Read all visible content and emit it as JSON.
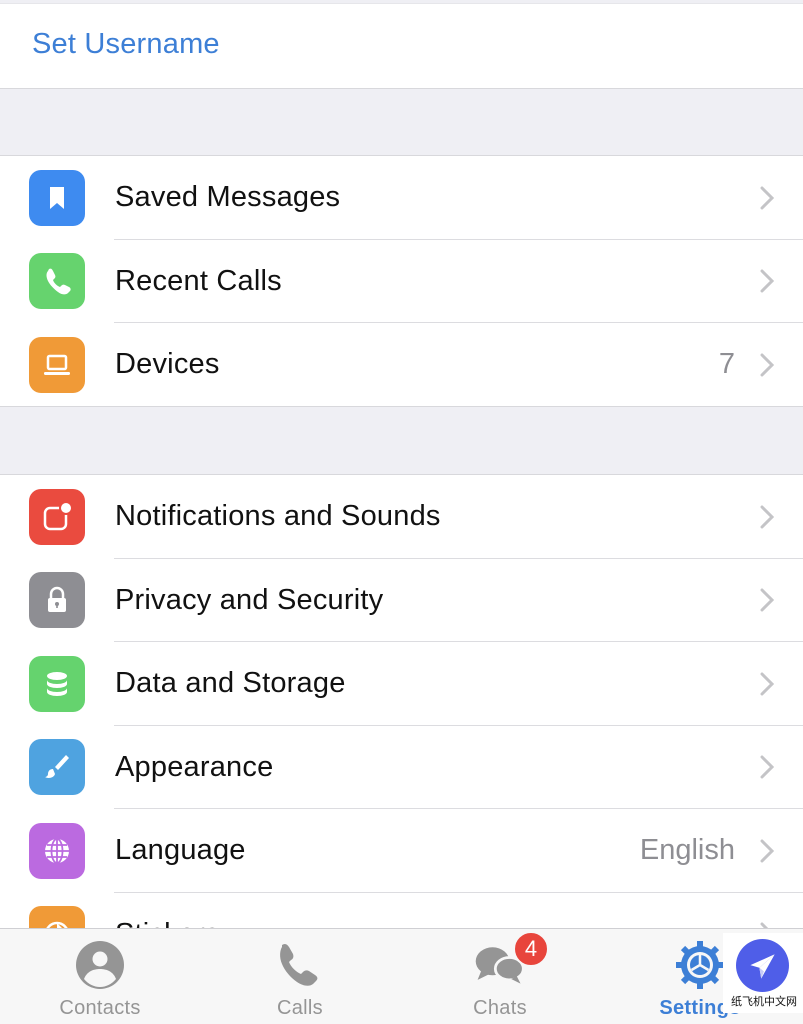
{
  "header": {
    "set_username_label": "Set Username"
  },
  "group1": [
    {
      "label": "Saved Messages",
      "icon": "bookmark-icon",
      "color": "#3e8bf0",
      "value": ""
    },
    {
      "label": "Recent Calls",
      "icon": "phone-icon",
      "color": "#66d36e",
      "value": ""
    },
    {
      "label": "Devices",
      "icon": "laptop-icon",
      "color": "#f09a37",
      "value": "7"
    }
  ],
  "group2": [
    {
      "label": "Notifications and Sounds",
      "icon": "notification-icon",
      "color": "#ea4b3f",
      "value": ""
    },
    {
      "label": "Privacy and Security",
      "icon": "lock-icon",
      "color": "#8e8e93",
      "value": ""
    },
    {
      "label": "Data and Storage",
      "icon": "database-icon",
      "color": "#65d36e",
      "value": ""
    },
    {
      "label": "Appearance",
      "icon": "brush-icon",
      "color": "#4fa3e0",
      "value": ""
    },
    {
      "label": "Language",
      "icon": "globe-icon",
      "color": "#bb6ae0",
      "value": "English"
    },
    {
      "label": "Stickers",
      "icon": "sticker-icon",
      "color": "#f09a37",
      "value": ""
    }
  ],
  "tabbar": {
    "tabs": [
      {
        "label": "Contacts",
        "icon": "person-circle-icon",
        "active": false
      },
      {
        "label": "Calls",
        "icon": "phone-icon",
        "active": false
      },
      {
        "label": "Chats",
        "icon": "chat-bubbles-icon",
        "active": false,
        "badge": "4"
      },
      {
        "label": "Settings",
        "icon": "gear-icon",
        "active": true
      }
    ]
  },
  "watermark": {
    "text": "纸飞机中文网"
  },
  "colors": {
    "accent": "#3d7fd6",
    "badge": "#e8453c",
    "inactive_tab": "#959595"
  }
}
